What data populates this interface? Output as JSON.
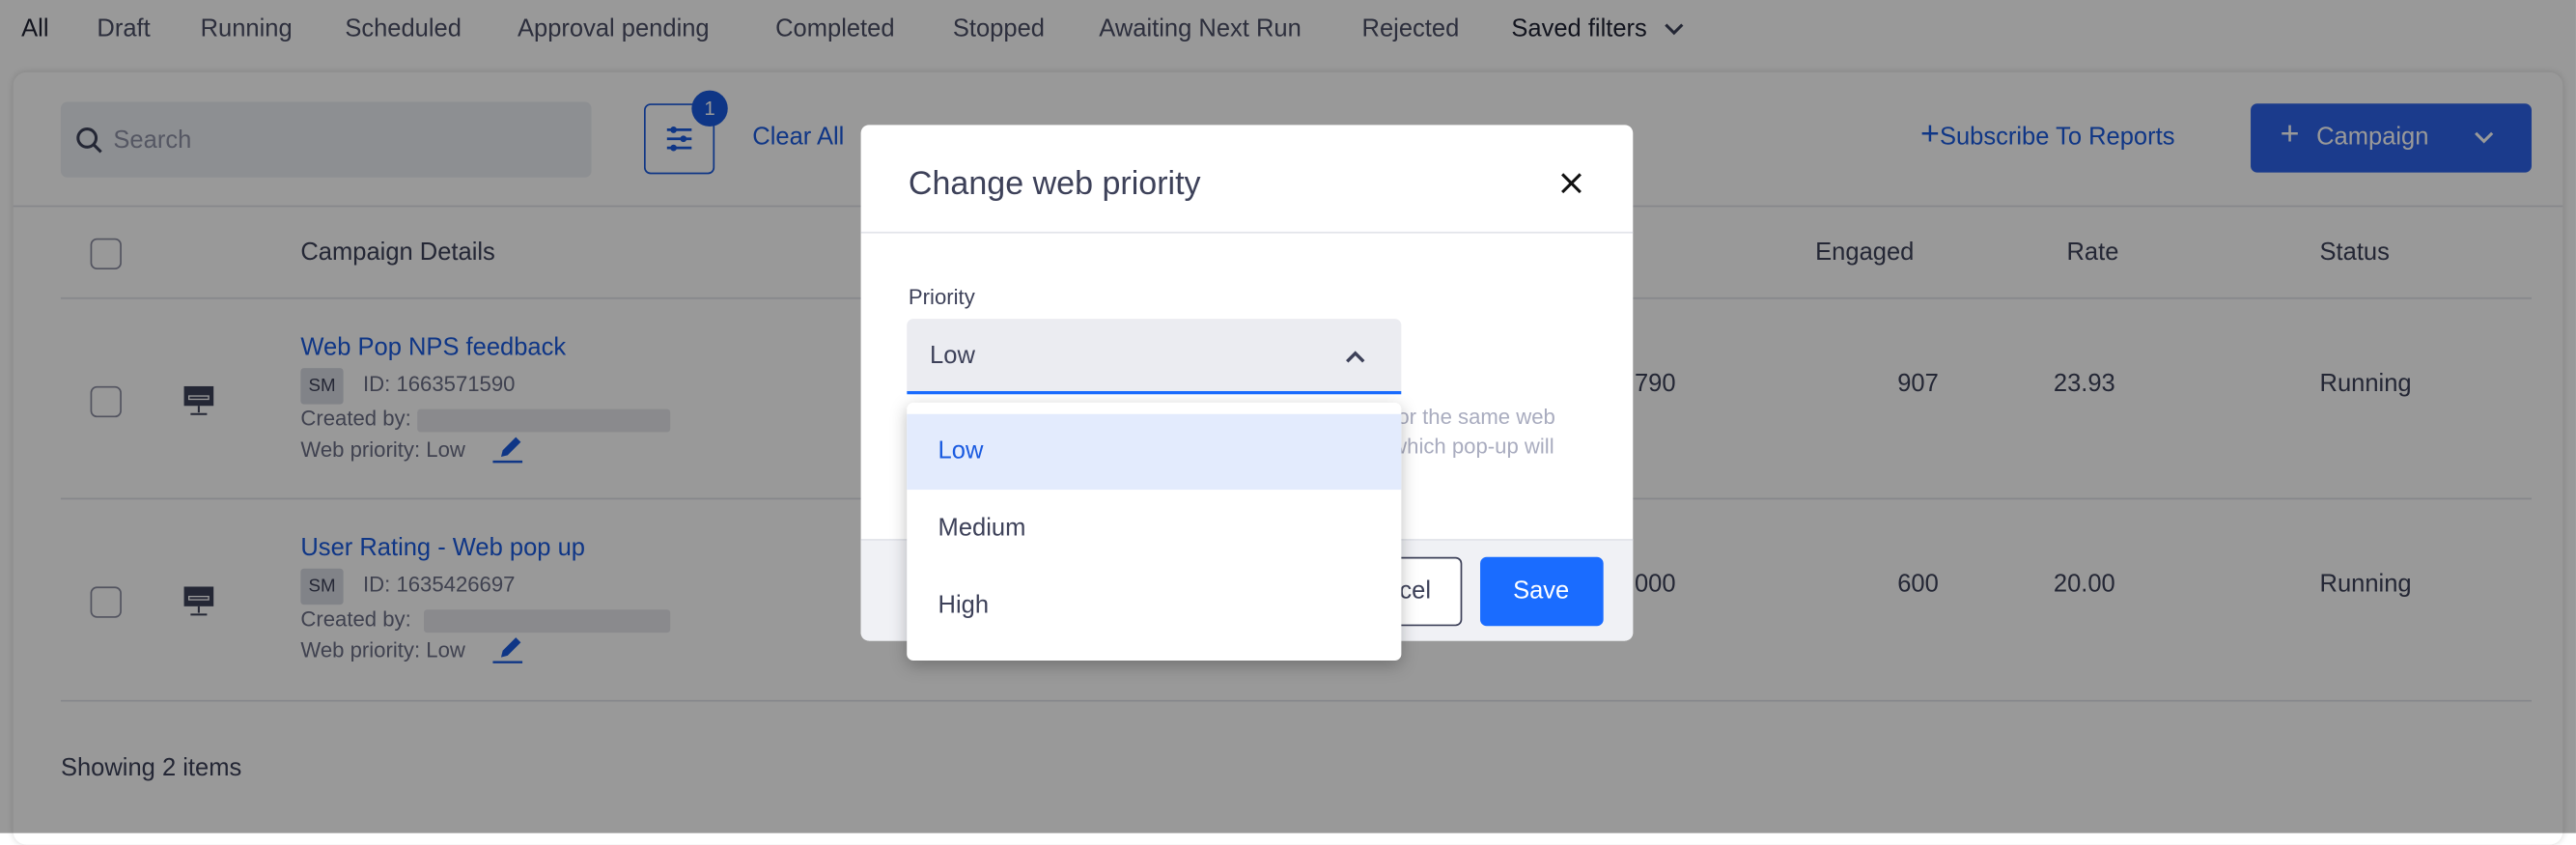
{
  "tabs": [
    "All",
    "Draft",
    "Running",
    "Scheduled",
    "Approval pending",
    "Completed",
    "Stopped",
    "Awaiting Next Run",
    "Rejected"
  ],
  "saved_filters": "Saved filters",
  "toolbar": {
    "search_placeholder": "Search",
    "filter_count": "1",
    "clear_all": "Clear All",
    "subscribe": "Subscribe To Reports",
    "campaign": "Campaign"
  },
  "table": {
    "headers": {
      "details": "Campaign Details",
      "engaged": "Engaged",
      "rate": "Rate",
      "status": "Status"
    },
    "rows": [
      {
        "title": "Web Pop NPS feedback",
        "badge": "SM",
        "id": "ID: 1663571590",
        "created_by": "Created by:",
        "priority": "Web priority: Low",
        "hidden_col": "790",
        "engaged": "907",
        "rate": "23.93",
        "status": "Running"
      },
      {
        "title": "User Rating - Web pop up",
        "badge": "SM",
        "id": "ID: 1635426697",
        "created_by": "Created by:",
        "priority": "Web priority: Low",
        "hidden_col": "000",
        "engaged": "600",
        "rate": "20.00",
        "status": "Running"
      }
    ],
    "footer": "Showing 2 items"
  },
  "modal": {
    "title": "Change web priority",
    "field_label": "Priority",
    "selected": "Low",
    "options": [
      "Low",
      "Medium",
      "High"
    ],
    "helper_lines": [
      "for the same web",
      "which pop-up will"
    ],
    "cancel": "cel",
    "save": "Save"
  },
  "colors": {
    "accent": "#1a5ae0",
    "save": "#1a6cff",
    "highlight": "#e3ebfd"
  }
}
